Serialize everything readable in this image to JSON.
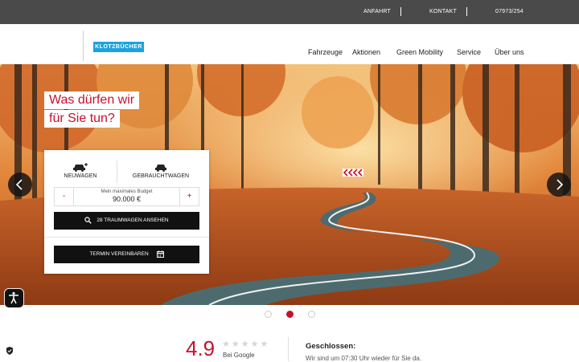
{
  "topbar": {
    "links": [
      "ANFAHRT",
      "KONTAKT",
      "07973/254"
    ]
  },
  "header": {
    "logo_text": "KLOTZBÜCHER",
    "nav": [
      "Fahrzeuge",
      "Aktionen",
      "Green Mobility",
      "Service",
      "Über uns"
    ]
  },
  "hero": {
    "headline": [
      "Was dürfen wir",
      "für Sie tun?"
    ],
    "tabs": [
      {
        "label": "NEUWAGEN",
        "icon": "new-car-icon"
      },
      {
        "label": "GEBRAUCHTWAGEN",
        "icon": "used-car-icon"
      }
    ],
    "budget": {
      "minus": "-",
      "plus": "+",
      "label": "Mein maximales Budget",
      "value": "90.000 €"
    },
    "search_button": "28 TRAUMWAGEN ANSEHEN",
    "appointment_button": "TERMIN VEREINBAREN",
    "slides": 3,
    "active_slide": 2
  },
  "rating": {
    "score": "4.9",
    "stars": "★★★★★",
    "source": "Bei Google"
  },
  "hours": {
    "title": "Geschlossen:",
    "text": "Wir sind um 07:30 Uhr wieder für Sie da."
  },
  "colors": {
    "accent": "#c8102e",
    "logo_blue": "#1aa3df",
    "topbar": "#4a4a4a"
  }
}
